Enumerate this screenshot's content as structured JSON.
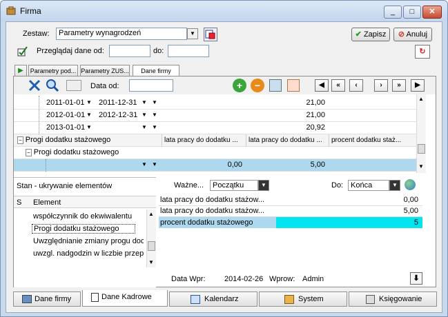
{
  "window": {
    "title": "Firma",
    "min": "_",
    "max": "□",
    "close": "✕"
  },
  "top": {
    "zestaw_label": "Zestaw:",
    "zestaw_value": "Parametry wynagrodzeń",
    "zapisz": "Zapisz",
    "anuluj": "Anuluj",
    "przegladaj_label": "Przeglądaj dane od:",
    "do_label": "do:",
    "od_value": "",
    "do_value": ""
  },
  "tabs": [
    "Parametry pod...",
    "Parametry ZUS...",
    "Dane firmy"
  ],
  "toolbar": {
    "data_od_label": "Data od:",
    "data_od_value": ""
  },
  "grid": {
    "date_rows": [
      {
        "from": "2011-01-01",
        "to": "2011-12-31",
        "value": "21,00"
      },
      {
        "from": "2012-01-01",
        "to": "2012-12-31",
        "value": "21,00"
      },
      {
        "from": "2013-01-01",
        "to": "",
        "value": "20,92"
      }
    ],
    "group1": "Progi dodatku stażowego",
    "group2": "Progi dodatku stażowego",
    "columns": [
      "lata pracy do dodatku ...",
      "lata pracy do dodatku ...",
      "procent dodatku staż..."
    ],
    "selected_row": {
      "c1": "0,00",
      "c2": "5,00",
      "c3": ""
    }
  },
  "lower_left": {
    "header": "Stan - ukrywanie elementów",
    "col_s": "S",
    "col_element": "Element",
    "items": [
      "współczynnik do ekwiwalentu",
      "Progi dodatku stażowego",
      "Uwzględnianie zmiany progu doc",
      "uwzgl. nadgodzin w liczbie przep"
    ]
  },
  "lower_right": {
    "wazne_label": "Ważne...",
    "wazne_value": "Początku",
    "do_label": "Do:",
    "do_value": "Końca",
    "rows": [
      {
        "label": "lata pracy do dodatku stażow...",
        "value": "0,00"
      },
      {
        "label": "lata pracy do dodatku stażow...",
        "value": "5,00"
      },
      {
        "label": "procent dodatku stażowego",
        "value": "5"
      }
    ]
  },
  "status": {
    "data_wpr_label": "Data Wpr:",
    "data_wpr_value": "2014-02-26",
    "wprow_label": "Wprow:",
    "wprow_value": "Admin"
  },
  "bottom_tabs": [
    "Dane firmy",
    "Dane Kadrowe",
    "Kalendarz",
    "System",
    "Księgowanie"
  ],
  "colors": {
    "selection": "#aed8ee",
    "highlight": "#00e5f0",
    "accent_green": "#3aa53a",
    "accent_red": "#d63b2a"
  }
}
